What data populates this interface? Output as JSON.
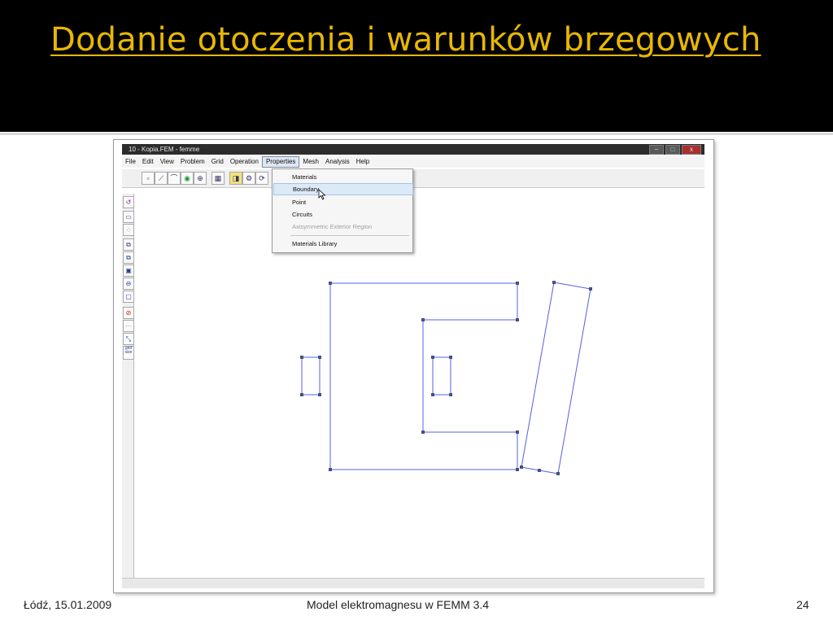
{
  "slide": {
    "title": "Dodanie otoczenia i warunków brzegowych",
    "footer_left": "Łódź, 15.01.2009",
    "footer_center": "Model elektromagnesu w FEMM 3.4",
    "page_number": "24"
  },
  "app": {
    "window_title": "10 - Kopia.FEM - femme",
    "menu": [
      "File",
      "Edit",
      "View",
      "Problem",
      "Grid",
      "Operation",
      "Properties",
      "Mesh",
      "Analysis",
      "Help"
    ],
    "active_menu": "Properties",
    "dropdown": {
      "items": [
        "Materials",
        "Boundary",
        "Point",
        "Circuits",
        "Axisymmetric Exterior Region"
      ],
      "library_item": "Materials Library",
      "hovered": "Boundary",
      "disabled": "Axisymmetric Exterior Region"
    },
    "side_tools": [
      "undo",
      "rectangle-select",
      "circle-select",
      "copy",
      "mirror",
      "scale",
      "zoom-in",
      "zoom-window",
      "delete",
      "grid",
      "snap",
      "grid-size"
    ],
    "grid_size_label": "grid\nsize",
    "colors": {
      "title": "#e8b800",
      "geometry_line": "#5560e0",
      "node": "#4a4f80",
      "hover": "#dce9f7"
    }
  }
}
